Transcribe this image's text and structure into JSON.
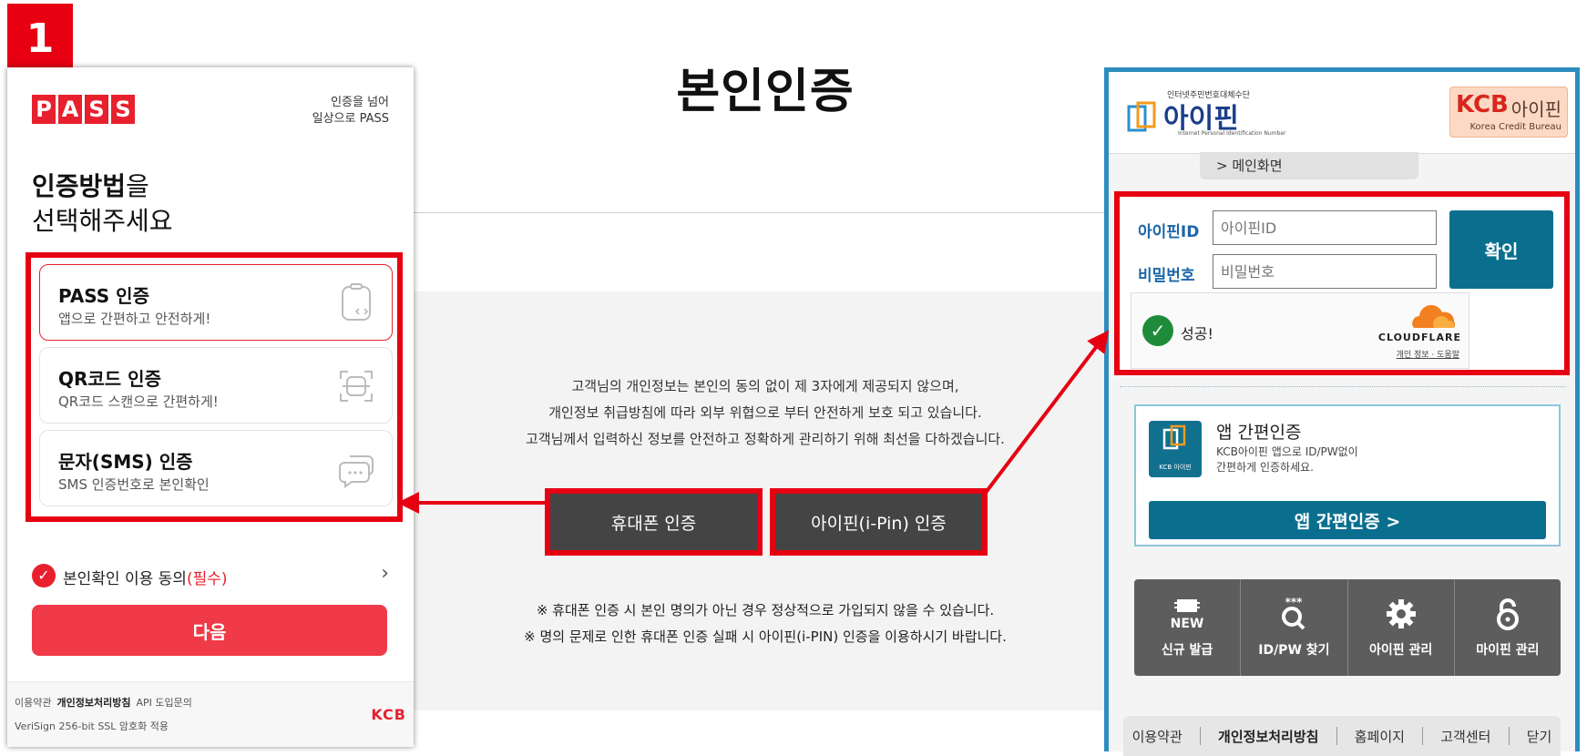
{
  "step": {
    "number": "1"
  },
  "page": {
    "title": "본인인증",
    "notice": [
      "고객님의 개인정보는 본인의 동의 없이 제 3자에게 제공되지 않으며,",
      "개인정보 취급방침에 따라 외부 위협으로 부터 안전하게 보호 되고 있습니다.",
      "고객님께서 입력하신 정보를 안전하고 정확하게 관리하기 위해 최선을 다하겠습니다."
    ],
    "buttons": {
      "phone": "휴대폰 인증",
      "ipin": "아이핀(i-Pin) 인증"
    },
    "warnings": [
      "※ 휴대폰 인증 시 본인 명의가 아닌 경우 정상적으로 가입되지 않을 수 있습니다.",
      "※ 명의 문제로 인한 휴대폰 인증 실패 시 아이핀(i-PIN) 인증을 이용하시기 바랍니다."
    ]
  },
  "pass": {
    "logo_letters": [
      "P",
      "A",
      "S",
      "S"
    ],
    "slogan_line1": "인증을 넘어",
    "slogan_line2": "일상으로 PASS",
    "heading_bold": "인증방법",
    "heading_rest": "을",
    "heading_line2": "선택해주세요",
    "options": [
      {
        "title": "PASS 인증",
        "desc": "앱으로 간편하고 안전하게!"
      },
      {
        "title": "QR코드 인증",
        "desc": "QR코드 스캔으로 간편하게!"
      },
      {
        "title": "문자(SMS) 인증",
        "desc": "SMS 인증번호로 본인확인"
      }
    ],
    "consent_text": "본인확인 이용 동의",
    "consent_required": "(필수)",
    "next_label": "다음",
    "footer": {
      "terms": "이용약관",
      "privacy": "개인정보처리방침",
      "api": "API 도입문의",
      "ssl": "VeriSign 256-bit SSL 암호화 적용",
      "brand": "KCB"
    }
  },
  "ipin": {
    "logo_small": "인터넷주민번호대체수단",
    "logo_text": "아이핀",
    "logo_tiny": "Internet Personal Identification Number",
    "kcb_brand": "KCB",
    "kcb_ipin": "아이핀",
    "kcb_sub": "Korea Credit Bureau",
    "breadcrumb": "> 메인화면",
    "id_label": "아이핀ID",
    "id_placeholder": "아이핀ID",
    "pw_label": "비밀번호",
    "pw_placeholder": "비밀번호",
    "confirm_label": "확인",
    "captcha_status": "성공!",
    "cloudflare_name": "CLOUDFLARE",
    "cloudflare_privacy": "개인 정보",
    "cloudflare_terms": "도움말",
    "app_icon_text": "KCB 아이핀",
    "app_title": "앱 간편인증",
    "app_desc_line1": "KCB아이핀 앱으로 ID/PW없이",
    "app_desc_line2": "간편하게 인증하세요.",
    "app_button": "앱 간편인증 >",
    "menu": [
      {
        "label": "신규 발급",
        "icon": "new-badge-icon"
      },
      {
        "label": "ID/PW 찾기",
        "icon": "search-password-icon"
      },
      {
        "label": "아이핀 관리",
        "icon": "gear-icon"
      },
      {
        "label": "마이핀 관리",
        "icon": "lock-icon"
      }
    ],
    "footer": [
      "이용약관",
      "개인정보처리방침",
      "홈페이지",
      "고객센터",
      "닫기"
    ]
  },
  "colors": {
    "highlight": "#e60012",
    "pass_red": "#e8202e",
    "ipin_teal": "#0a6f8e",
    "dark_button": "#444444"
  }
}
